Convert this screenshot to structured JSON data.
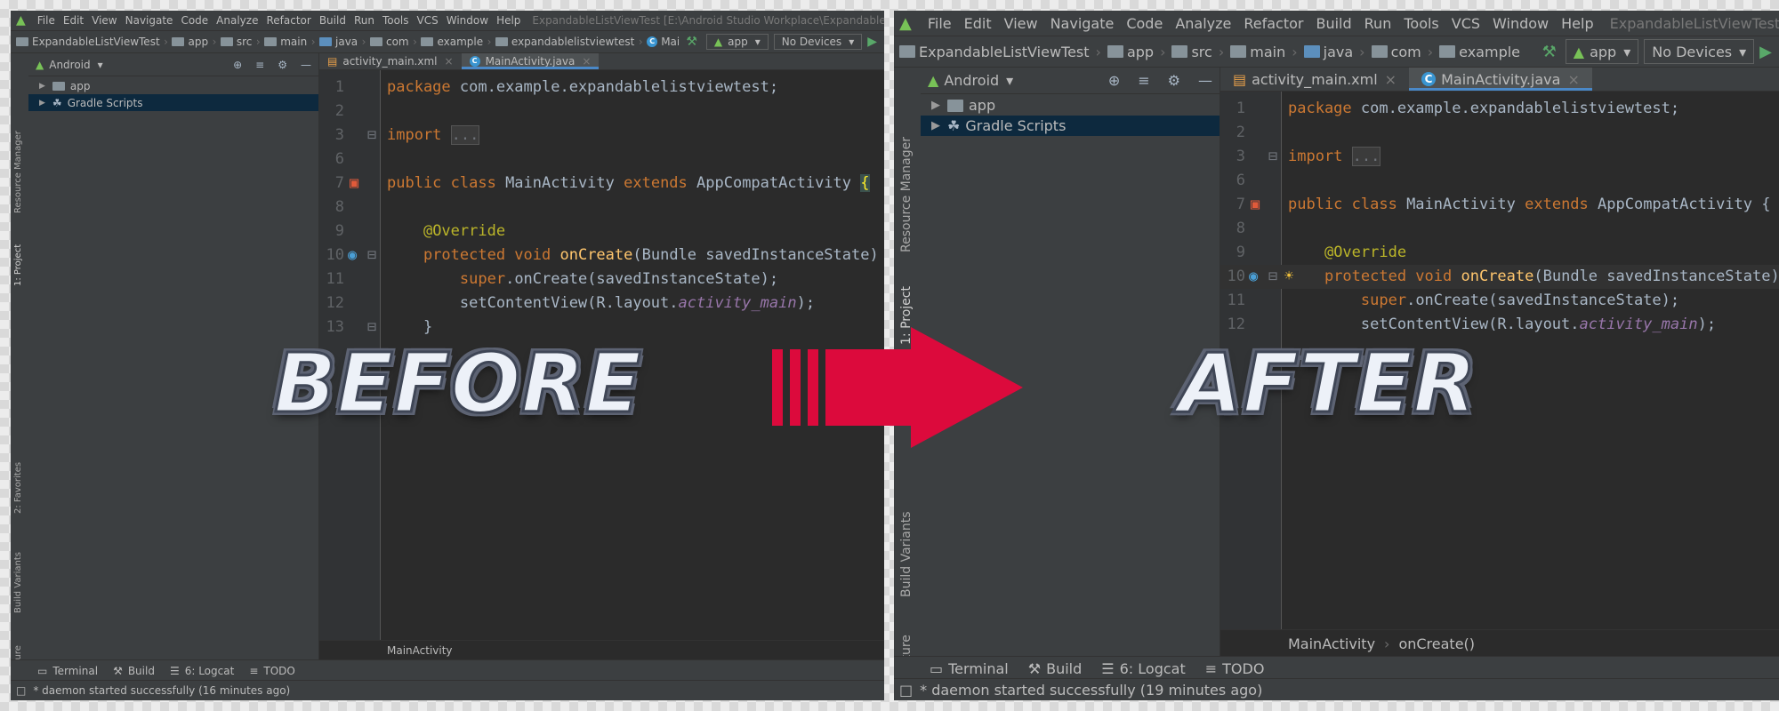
{
  "menu_items": [
    "File",
    "Edit",
    "View",
    "Navigate",
    "Code",
    "Analyze",
    "Refactor",
    "Build",
    "Run",
    "Tools",
    "VCS",
    "Window",
    "Help"
  ],
  "colors": {
    "ide_background": "#2b2b2b",
    "panel_background": "#3c3f41",
    "keyword": "#cc7832",
    "function": "#ffc66d",
    "annotation": "#bbb529",
    "field_italic": "#9876aa",
    "default_text": "#a9b7c6",
    "arrow": "#dc0a3c",
    "label_fill": "#edf1f8",
    "label_outline": "#5d6373"
  },
  "code_lines": [
    {
      "num": "1",
      "parts": [
        [
          "kw",
          "package "
        ],
        [
          "",
          "com.example.expandablelistviewtest;"
        ]
      ]
    },
    {
      "num": "2",
      "parts": []
    },
    {
      "num": "3",
      "parts": [
        [
          "kw",
          "import "
        ],
        [
          "fold",
          "..."
        ]
      ]
    },
    {
      "num": "6",
      "parts": []
    },
    {
      "num": "7",
      "parts": [
        [
          "kw",
          "public class "
        ],
        [
          "",
          "MainActivity "
        ],
        [
          "kw",
          "extends "
        ],
        [
          "",
          "AppCompatActivity "
        ],
        [
          "brace",
          "{"
        ]
      ]
    },
    {
      "num": "8",
      "parts": []
    },
    {
      "num": "9",
      "parts": [
        [
          "",
          "    "
        ],
        [
          "ann",
          "@Override"
        ]
      ]
    },
    {
      "num": "10",
      "parts": [
        [
          "",
          "    "
        ],
        [
          "kw",
          "protected void "
        ],
        [
          "fn",
          "onCreate"
        ],
        [
          "",
          "(Bundle savedInstanceState) {"
        ]
      ]
    },
    {
      "num": "11",
      "parts": [
        [
          "",
          "        "
        ],
        [
          "kw",
          "super"
        ],
        [
          "",
          ".onCreate(savedInstanceState);"
        ]
      ]
    },
    {
      "num": "12",
      "parts": [
        [
          "",
          "        setContentView(R.layout."
        ],
        [
          "fld",
          "activity_main"
        ],
        [
          "",
          ");"
        ]
      ]
    },
    {
      "num": "13",
      "parts": [
        [
          "",
          "    }"
        ]
      ]
    }
  ],
  "before": {
    "window_title": "ExpandableListViewTest [E:\\Android Studio Workplace\\ExpandableListViewTest]",
    "breadcrumbs": [
      "ExpandableListViewTest",
      "app",
      "src",
      "main",
      "java",
      "com",
      "example",
      "expandablelistviewtest",
      "MainActivity"
    ],
    "run_config": "app",
    "devices": "No Devices",
    "project_view": "Android",
    "tree": [
      {
        "label": "app",
        "selected": false
      },
      {
        "label": "Gradle Scripts",
        "selected": true
      }
    ],
    "tabs": [
      {
        "label": "activity_main.xml",
        "active": false
      },
      {
        "label": "MainActivity.java",
        "active": true
      }
    ],
    "side_tabs": [
      "Resource Manager",
      "1: Project",
      "2: Favorites",
      "Build Variants",
      "Z: Structure"
    ],
    "editor_breadcrumb": [
      "MainActivity"
    ],
    "bottom_tabs": [
      "Terminal",
      "Build",
      "6: Logcat",
      "TODO"
    ],
    "status": "* daemon started successfully (16 minutes ago)",
    "label": "BEFORE"
  },
  "after": {
    "window_title": "ExpandableListViewTest [...\\ExpandableListViewTest]",
    "breadcrumbs": [
      "ExpandableListViewTest",
      "app",
      "src",
      "main",
      "java",
      "com",
      "example"
    ],
    "run_config": "app",
    "devices": "No Devices",
    "project_view": "Android",
    "tree": [
      {
        "label": "app",
        "selected": false
      },
      {
        "label": "Gradle Scripts",
        "selected": true
      }
    ],
    "tabs": [
      {
        "label": "activity_main.xml",
        "active": false
      },
      {
        "label": "MainActivity.java",
        "active": true
      }
    ],
    "side_tabs": [
      "Resource Manager",
      "1: Project",
      "Build Variants",
      "Z: Structure"
    ],
    "editor_breadcrumb": [
      "MainActivity",
      "onCreate()"
    ],
    "bottom_tabs": [
      "Terminal",
      "Build",
      "6: Logcat",
      "TODO"
    ],
    "status": "* daemon started successfully (19 minutes ago)",
    "label": "AFTER"
  }
}
